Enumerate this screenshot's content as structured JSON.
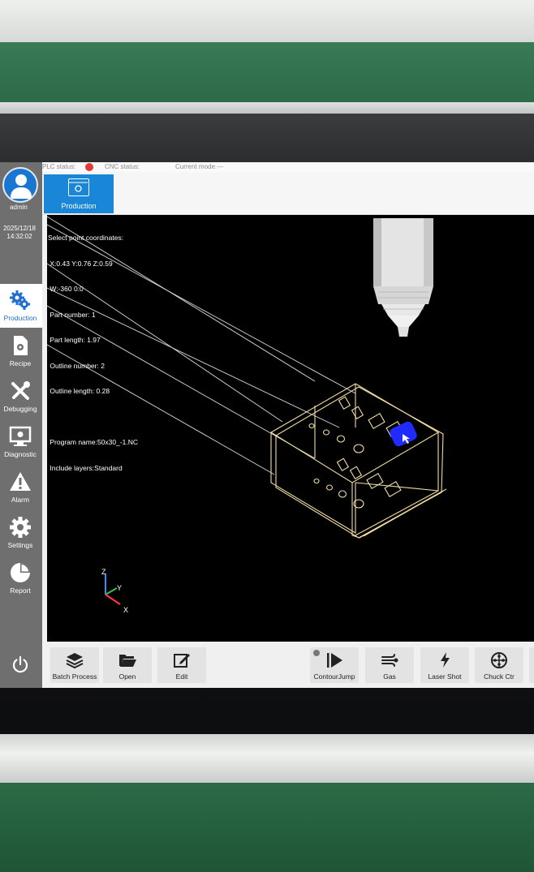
{
  "status": {
    "plc_label": "PLC status:",
    "cnc_label": "CNC status:",
    "mode_label": "Current mode:---"
  },
  "user": {
    "name": "admin",
    "date": "2025/12/18",
    "time": "14:32:02"
  },
  "nav": [
    {
      "label": "Production",
      "icon": "gears-icon",
      "active": true
    },
    {
      "label": "Recipe",
      "icon": "recipe-file-icon"
    },
    {
      "label": "Debugging",
      "icon": "tools-icon"
    },
    {
      "label": "Diagnostic",
      "icon": "monitor-icon"
    },
    {
      "label": "Alarm",
      "icon": "warning-icon"
    },
    {
      "label": "Settings",
      "icon": "gear-icon"
    },
    {
      "label": "Report",
      "icon": "pie-chart-icon"
    }
  ],
  "tab": {
    "label": "Production"
  },
  "info": {
    "line1": "Select point coordinates:",
    "line2": " X:0.43 Y:0.76 Z:0.59",
    "line3": " W:-360 0:0",
    "line4": " Part number: 1",
    "line5": " Part length: 1.97",
    "line6": " Outline number: 2",
    "line7": " Outline length: 0.28",
    "line8": " Program name:50x30_-1.NC",
    "line9": " Include layers:Standard"
  },
  "axes": {
    "z": "Z",
    "y": "Y",
    "x": "X"
  },
  "toolbar": {
    "batch": "Batch Process",
    "open": "Open",
    "edit": "Edit",
    "contour": "ContourJump",
    "gas": "Gas",
    "laser": "Laser Shot",
    "chuck": "Chuck Ctr"
  },
  "colors": {
    "accent": "#1a86d8",
    "sidebar": "#6f6f6f",
    "part_outline": "#f2dca2",
    "selection": "#1f2bff",
    "plc_status": "#e53935"
  }
}
